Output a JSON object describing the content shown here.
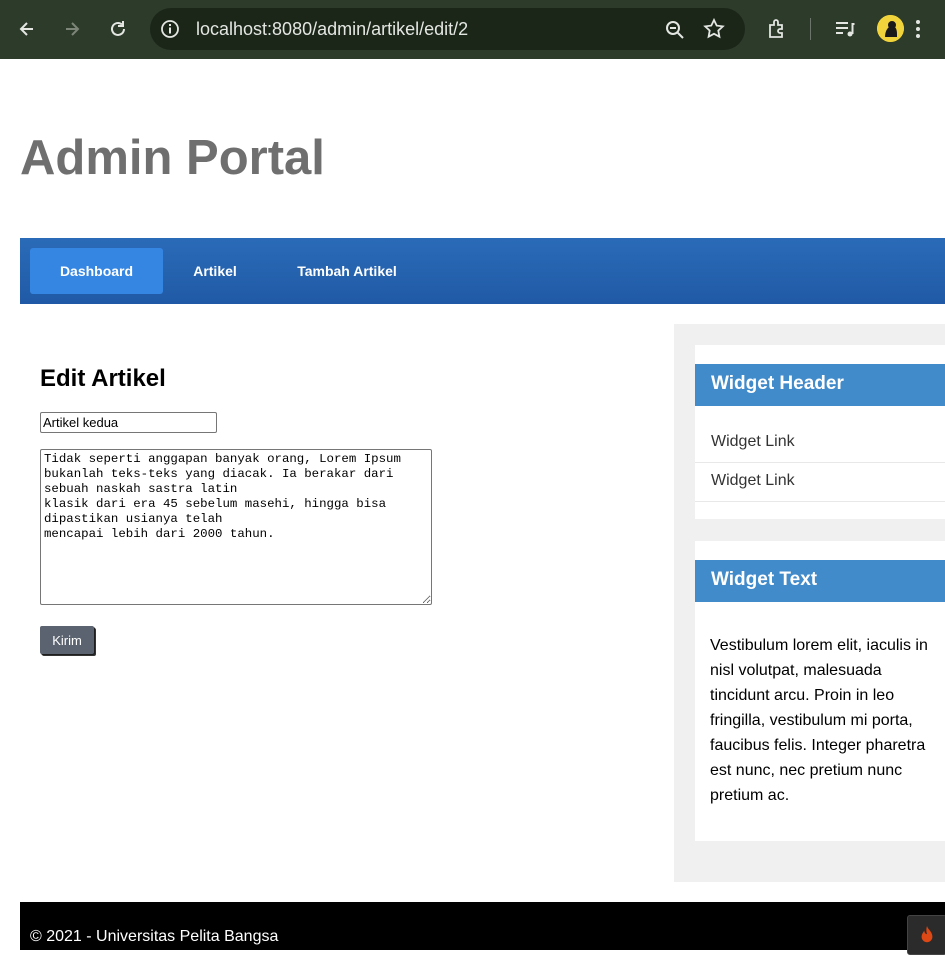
{
  "browser": {
    "url": "localhost:8080/admin/artikel/edit/2"
  },
  "site": {
    "title": "Admin Portal"
  },
  "nav": {
    "items": [
      {
        "label": "Dashboard",
        "active": true
      },
      {
        "label": "Artikel",
        "active": false
      },
      {
        "label": "Tambah Artikel",
        "active": false
      }
    ]
  },
  "form": {
    "heading": "Edit Artikel",
    "title_value": "Artikel kedua",
    "content_value": "Tidak seperti anggapan banyak orang, Lorem Ipsum bukanlah teks-teks yang diacak. Ia berakar dari sebuah naskah sastra latin\nklasik dari era 45 sebelum masehi, hingga bisa dipastikan usianya telah\nmencapai lebih dari 2000 tahun.",
    "submit_label": "Kirim"
  },
  "sidebar": {
    "widget1": {
      "header": "Widget Header",
      "links": [
        "Widget Link",
        "Widget Link"
      ]
    },
    "widget2": {
      "header": "Widget Text",
      "text": "Vestibulum lorem elit, iaculis in nisl volutpat, malesuada tincidunt arcu. Proin in leo fringilla, vestibulum mi porta, faucibus felis. Integer pharetra est nunc, nec pretium nunc pretium ac."
    }
  },
  "footer": {
    "text": "© 2021 - Universitas Pelita Bangsa"
  },
  "colors": {
    "navbar": "#2a6bb8",
    "nav_active": "#3586e2",
    "widget_header": "#428bca",
    "footer": "#000000"
  }
}
